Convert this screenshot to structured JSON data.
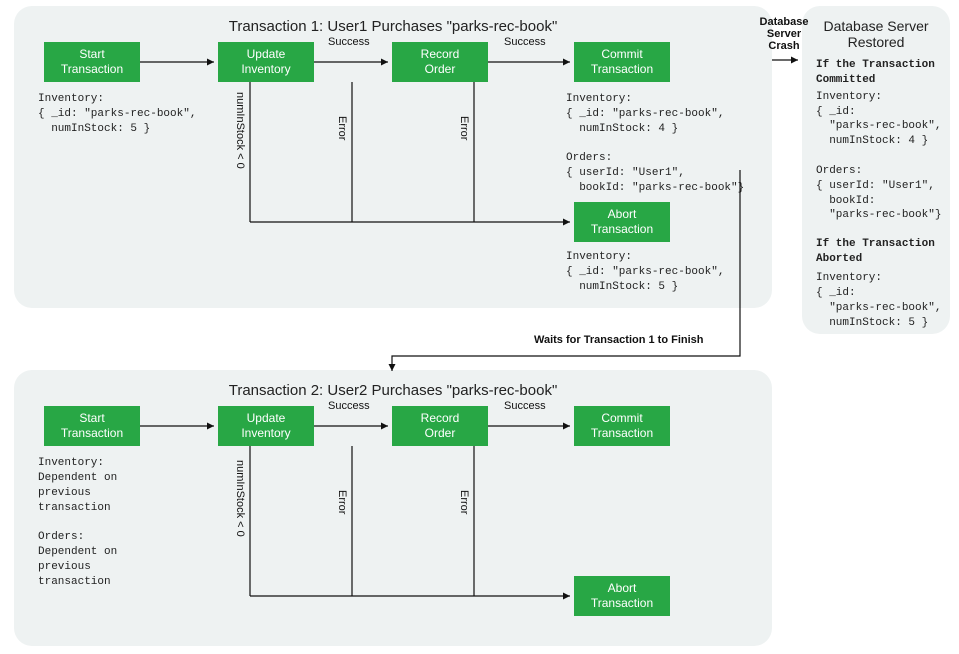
{
  "panel1": {
    "title": "Transaction 1: User1 Purchases \"parks-rec-book\"",
    "steps": {
      "start": "Start\nTransaction",
      "update": "Update\nInventory",
      "record": "Record\nOrder",
      "commit": "Commit\nTransaction",
      "abort": "Abort\nTransaction"
    },
    "labels": {
      "success1": "Success",
      "success2": "Success",
      "numInStock": "numInStock < 0",
      "error1": "Error",
      "error2": "Error"
    },
    "info_start": "Inventory:\n{ _id: \"parks-rec-book\",\n  numInStock: 5 }",
    "info_commit": "Inventory:\n{ _id: \"parks-rec-book\",\n  numInStock: 4 }\n\nOrders:\n{ userId: \"User1\",\n  bookId: \"parks-rec-book\"}",
    "info_abort": "Inventory:\n{ _id: \"parks-rec-book\",\n  numInStock: 5 }"
  },
  "panel2": {
    "title": "Transaction 2: User2 Purchases \"parks-rec-book\"",
    "steps": {
      "start": "Start\nTransaction",
      "update": "Update\nInventory",
      "record": "Record\nOrder",
      "commit": "Commit\nTransaction",
      "abort": "Abort\nTransaction"
    },
    "labels": {
      "success1": "Success",
      "success2": "Success",
      "numInStock": "numInStock < 0",
      "error1": "Error",
      "error2": "Error"
    },
    "info_start": "Inventory:\nDependent on\nprevious\ntransaction\n\nOrders:\nDependent on\nprevious\ntransaction"
  },
  "side": {
    "title": "Database Server\nRestored",
    "h1": "If the Transaction\nCommitted",
    "body1": "Inventory:\n{ _id:\n  \"parks-rec-book\",\n  numInStock: 4 }\n\nOrders:\n{ userId: \"User1\",\n  bookId:\n  \"parks-rec-book\"}",
    "h2": "If the Transaction\nAborted",
    "body2": "Inventory:\n{ _id:\n  \"parks-rec-book\",\n  numInStock: 5 }"
  },
  "edges": {
    "crash": "Database\nServer\nCrash",
    "waits": "Waits for Transaction 1 to Finish"
  }
}
